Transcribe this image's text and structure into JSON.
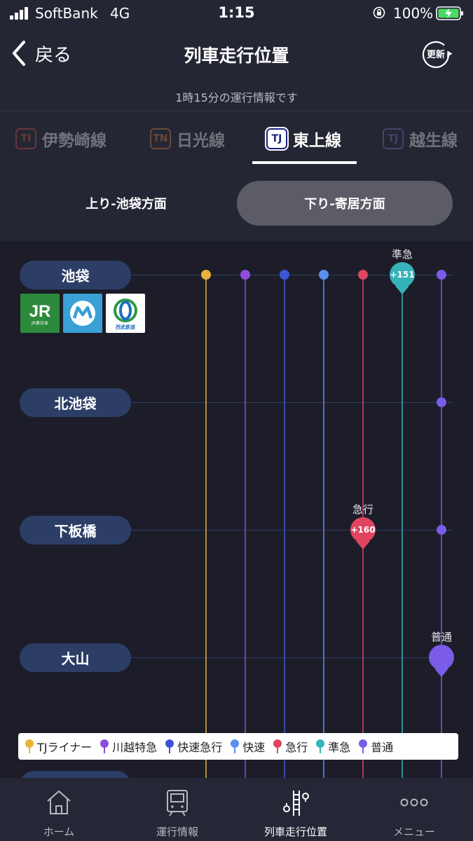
{
  "status_bar": {
    "carrier": "SoftBank",
    "network": "4G",
    "time": "1:15",
    "battery": "100%"
  },
  "nav": {
    "back_label": "戻る",
    "title": "列車走行位置",
    "refresh_label": "更新",
    "info": "1時15分の運行情報です"
  },
  "line_tabs": [
    {
      "code": "TI",
      "name": "伊勢崎線",
      "color": "#e85a3c",
      "active": false
    },
    {
      "code": "TN",
      "name": "日光線",
      "color": "#f08c3a",
      "active": false
    },
    {
      "code": "TJ",
      "name": "東上線",
      "color": "#1a237e",
      "active": true
    },
    {
      "code": "TJ",
      "name": "越生線",
      "color": "#3f51b5",
      "active": false
    }
  ],
  "direction": {
    "up_label": "上り-池袋方面",
    "down_label": "下り-寄居方面",
    "selected": "down"
  },
  "stations": [
    "池袋",
    "北池袋",
    "下板橋",
    "大山"
  ],
  "transfer_logos": [
    {
      "name": "JR東日本",
      "color": "#2c8a3c",
      "icon": "jr-logo"
    },
    {
      "name": "東京メトロ",
      "color": "#3aa0d5",
      "icon": "metro-logo"
    },
    {
      "name": "西武鉄道",
      "color": "#ffffff",
      "icon": "seibu-logo"
    }
  ],
  "train_types": [
    {
      "name": "TJライナー",
      "color": "#e9b33a"
    },
    {
      "name": "川越特急",
      "color": "#8e4de0"
    },
    {
      "name": "快速急行",
      "color": "#3e55d9"
    },
    {
      "name": "快速",
      "color": "#5b8ff0"
    },
    {
      "name": "急行",
      "color": "#e0455f"
    },
    {
      "name": "準急",
      "color": "#35b3b8"
    },
    {
      "name": "普通",
      "color": "#7a5ce8"
    }
  ],
  "trains": [
    {
      "type": "準急",
      "delay": "+151",
      "color": "#35b3b8",
      "station": "池袋"
    },
    {
      "type": "急行",
      "delay": "+160",
      "color": "#e0455f",
      "station": "下板橋"
    },
    {
      "type": "普通",
      "delay": "",
      "color": "#7a5ce8",
      "station": "大山"
    }
  ],
  "tab_bar": [
    {
      "label": "ホーム",
      "icon": "home-icon",
      "active": false
    },
    {
      "label": "運行情報",
      "icon": "train-icon",
      "active": false
    },
    {
      "label": "列車走行位置",
      "icon": "train-position-icon",
      "active": true
    },
    {
      "label": "メニュー",
      "icon": "more-dots-icon",
      "active": false
    }
  ]
}
